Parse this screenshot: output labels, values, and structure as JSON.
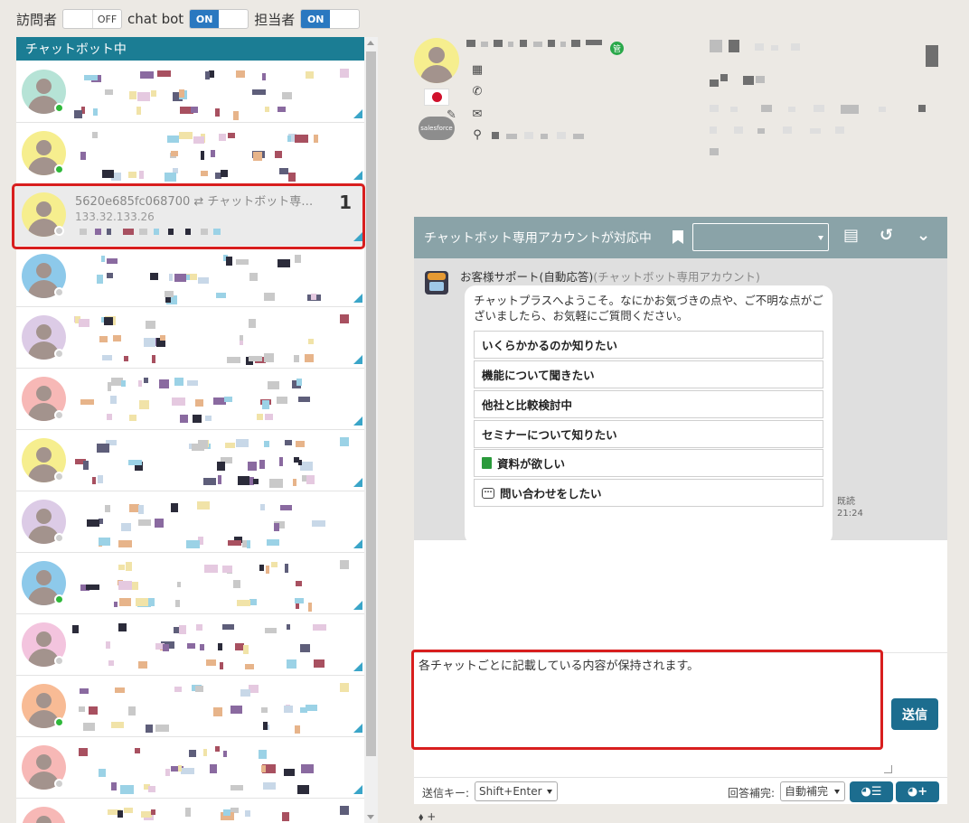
{
  "topbar": {
    "visitor_label": "訪問者",
    "visitor_toggle": "OFF",
    "chatbot_label": "chat bot",
    "chatbot_toggle": "ON",
    "owner_label": "担当者",
    "owner_toggle": "ON"
  },
  "left_panel": {
    "header": "チャットボット中",
    "active_item": {
      "id": "5620e685fc068700 ⇄ チャットボット専…",
      "ip": "133.32.133.26",
      "count": "1"
    }
  },
  "chat": {
    "header_title": "チャットボット専用アカウントが対応中",
    "header_select_value": "",
    "sender_name": "お客様サポート(自動応答)",
    "sender_sub": "(チャットボット専用アカウント)",
    "welcome_text": "チャットプラスへようこそ。なにかお気づきの点や、ご不明な点がございましたら、お気軽にご質問ください。",
    "options": [
      "いくらかかるのか知りたい",
      "機能について聞きたい",
      "他社と比較検討中",
      "セミナーについて知りたい",
      "資料が欲しい",
      "問い合わせをしたい"
    ],
    "read_label": "既読",
    "read_time": "21:24",
    "input_text": "各チャットごとに記載している内容が保持されます。",
    "send_button": "送信",
    "send_key_label": "送信キー:",
    "send_key_value": "Shift+Enter",
    "completion_label": "回答補完:",
    "completion_value": "自動補完",
    "tag_plus": "+"
  },
  "colors": {
    "teal_header": "#1b7d94",
    "chat_header": "#8aa3a8",
    "button_blue": "#1c6d8f",
    "toggle_on": "#2a78c0",
    "highlight_red": "#d81e1e"
  }
}
